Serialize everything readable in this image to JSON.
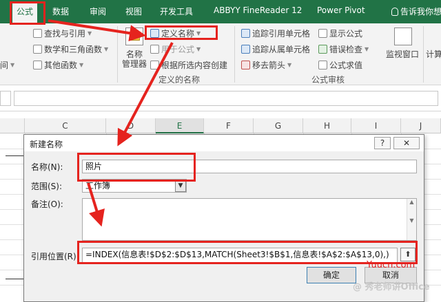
{
  "ribbon_tabs": {
    "formulas": "公式",
    "data": "数据",
    "review": "审阅",
    "view": "视图",
    "developer": "开发工具",
    "abbyy": "ABBYY FineReader 12",
    "powerpivot": "Power Pivot",
    "tellme": "告诉我你想要"
  },
  "ribbon": {
    "lookup": "查找与引用",
    "math": "数学和三角函数",
    "other_functions": "其他函数",
    "datetime": "间",
    "name_manager_line1": "名称",
    "name_manager_line2": "管理器",
    "define_name": "定义名称",
    "use_in_formula": "用于公式",
    "create_from_selection": "根据所选内容创建",
    "defined_names_group": "定义的名称",
    "trace_precedents": "追踪引用单元格",
    "trace_dependents": "追踪从属单元格",
    "remove_arrows": "移去箭头",
    "show_formulas": "显示公式",
    "error_checking": "错误检查",
    "evaluate_formula": "公式求值",
    "formula_auditing_group": "公式审核",
    "watch_window": "监视窗口",
    "calculation": "计算"
  },
  "columns": [
    "C",
    "D",
    "E",
    "F",
    "G",
    "H",
    "I",
    "J"
  ],
  "dialog": {
    "title": "新建名称",
    "help": "?",
    "close": "✕",
    "name_label": "名称(N):",
    "name_value": "照片",
    "scope_label": "范围(S):",
    "scope_value": "工作簿",
    "comment_label": "备注(O):",
    "refers_label": "引用位置(R):",
    "refers_value": "=INDEX(信息表!$D$2:$D$13,MATCH(Sheet3!$B$1,信息表!$A$2:$A$13,0),)",
    "ok": "确定",
    "cancel": "取消"
  },
  "watermarks": {
    "site": "Yuucn.com",
    "account": "@ 秀老师讲Office"
  }
}
